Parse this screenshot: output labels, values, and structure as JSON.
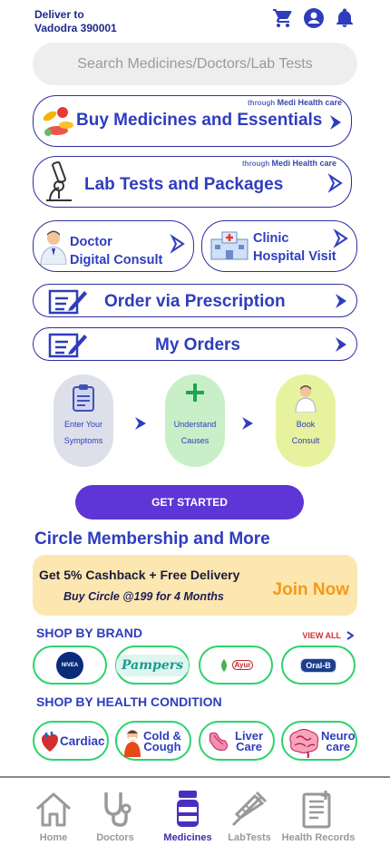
{
  "header": {
    "deliver_label": "Deliver to",
    "location": "Vadodra 390001",
    "icons": [
      "cart-icon",
      "account-icon",
      "bell-icon"
    ]
  },
  "search": {
    "placeholder": "Search Medicines/Doctors/Lab Tests"
  },
  "services": {
    "buy_medicines": {
      "label": "Buy Medicines and Essentials",
      "through": "through",
      "provider": "Medi Health care"
    },
    "lab_tests": {
      "label": "Lab Tests and Packages",
      "through": "through",
      "provider": "Medi Health care"
    },
    "doctor_line1": "Doctor",
    "doctor_line2": "Digital Consult",
    "clinic_line1": "Clinic",
    "clinic_line2": "Hospital Visit",
    "prescription": "Order via Prescription",
    "my_orders": "My Orders"
  },
  "steps": [
    {
      "line1": "Enter Your",
      "line2": "Symptoms"
    },
    {
      "line1": "Understand",
      "line2": "Causes"
    },
    {
      "line1": "Book",
      "line2": "Consult"
    }
  ],
  "get_started": "GET STARTED",
  "circle": {
    "title": "Circle Membership and More",
    "line1": "Get 5% Cashback + Free Delivery",
    "line2": "Buy Circle @199 for 4 Months",
    "join": "Join Now"
  },
  "brands": {
    "title": "SHOP BY BRAND",
    "view_all": "VIEW ALL",
    "items": [
      "NIVEA",
      "Pampers",
      "Ayur",
      "Oral-B"
    ]
  },
  "conditions": {
    "title": "SHOP BY HEALTH CONDITION",
    "cardiac": "Cardiac",
    "cold_line1": "Cold &",
    "cold_line2": "Cough",
    "liver_line1": "Liver",
    "liver_line2": "Care",
    "neuro_line1": "Neuro",
    "neuro_line2": "care"
  },
  "tabs": [
    "Home",
    "Doctors",
    "Medicines",
    "LabTests",
    "Health Records"
  ],
  "colors": {
    "accent": "#2e3dbd",
    "green": "#2bd36b",
    "purple": "#5e35d6",
    "orange": "#f39a1b",
    "cream": "#fde7b0"
  }
}
